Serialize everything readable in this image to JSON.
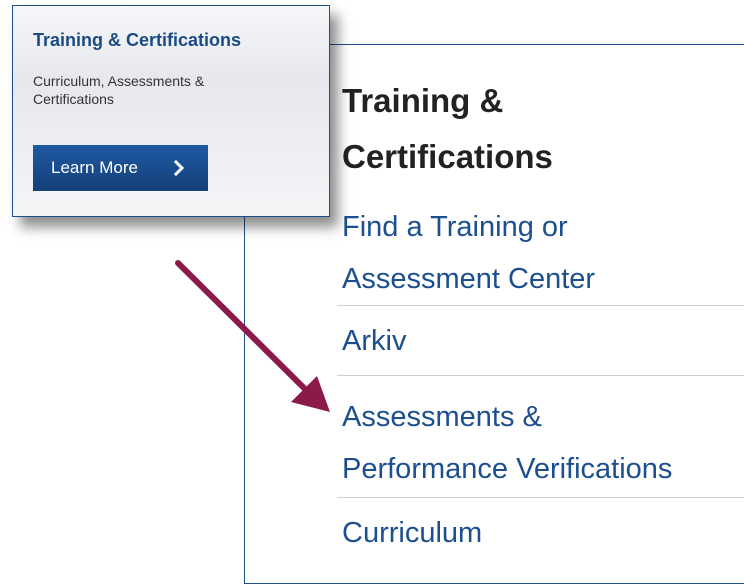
{
  "promo_card": {
    "title": "Training & Certifications",
    "subtitle": "Curriculum, Assessments & Certifications",
    "button_label": "Learn More",
    "button_icon": "chevron-right-icon"
  },
  "menu": {
    "heading_line1": "Training &",
    "heading_line2": "Certifications",
    "items": [
      {
        "line1": "Find a Training or",
        "line2": "Assessment Center"
      },
      {
        "line1": "Arkiv"
      },
      {
        "line1": "Assessments &",
        "line2": "Performance Verifications"
      },
      {
        "line1": "Curriculum"
      }
    ]
  },
  "annotation": {
    "arrow_icon": "arrow-icon"
  },
  "colors": {
    "brand_blue": "#1c4f90",
    "button_blue": "#174a8c",
    "heading_text": "#222222",
    "arrow": "#8b1a4a",
    "divider": "#cfcfcf"
  }
}
